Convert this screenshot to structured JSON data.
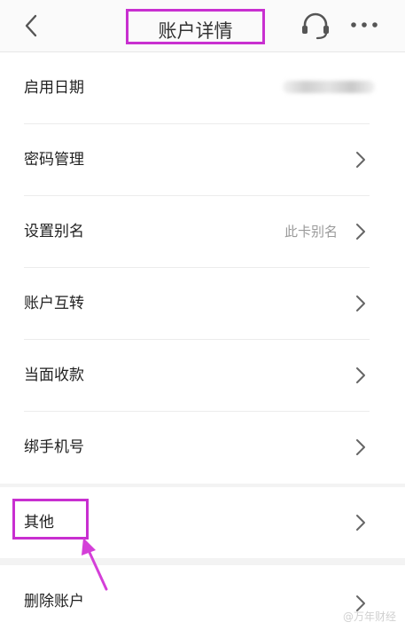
{
  "header": {
    "title": "账户详情"
  },
  "section1": {
    "rows": [
      {
        "label": "启用日期",
        "value": ""
      },
      {
        "label": "密码管理",
        "value": ""
      },
      {
        "label": "设置别名",
        "value": "此卡别名"
      },
      {
        "label": "账户互转",
        "value": ""
      },
      {
        "label": "当面收款",
        "value": ""
      },
      {
        "label": "绑手机号",
        "value": ""
      }
    ]
  },
  "section2": {
    "rows": [
      {
        "label": "其他"
      }
    ]
  },
  "section3": {
    "rows": [
      {
        "label": "删除账户"
      }
    ]
  },
  "watermark": "@万年财经",
  "colors": {
    "highlight": "#c82fd0",
    "background": "#ffffff",
    "separator": "#f3f3f3"
  }
}
